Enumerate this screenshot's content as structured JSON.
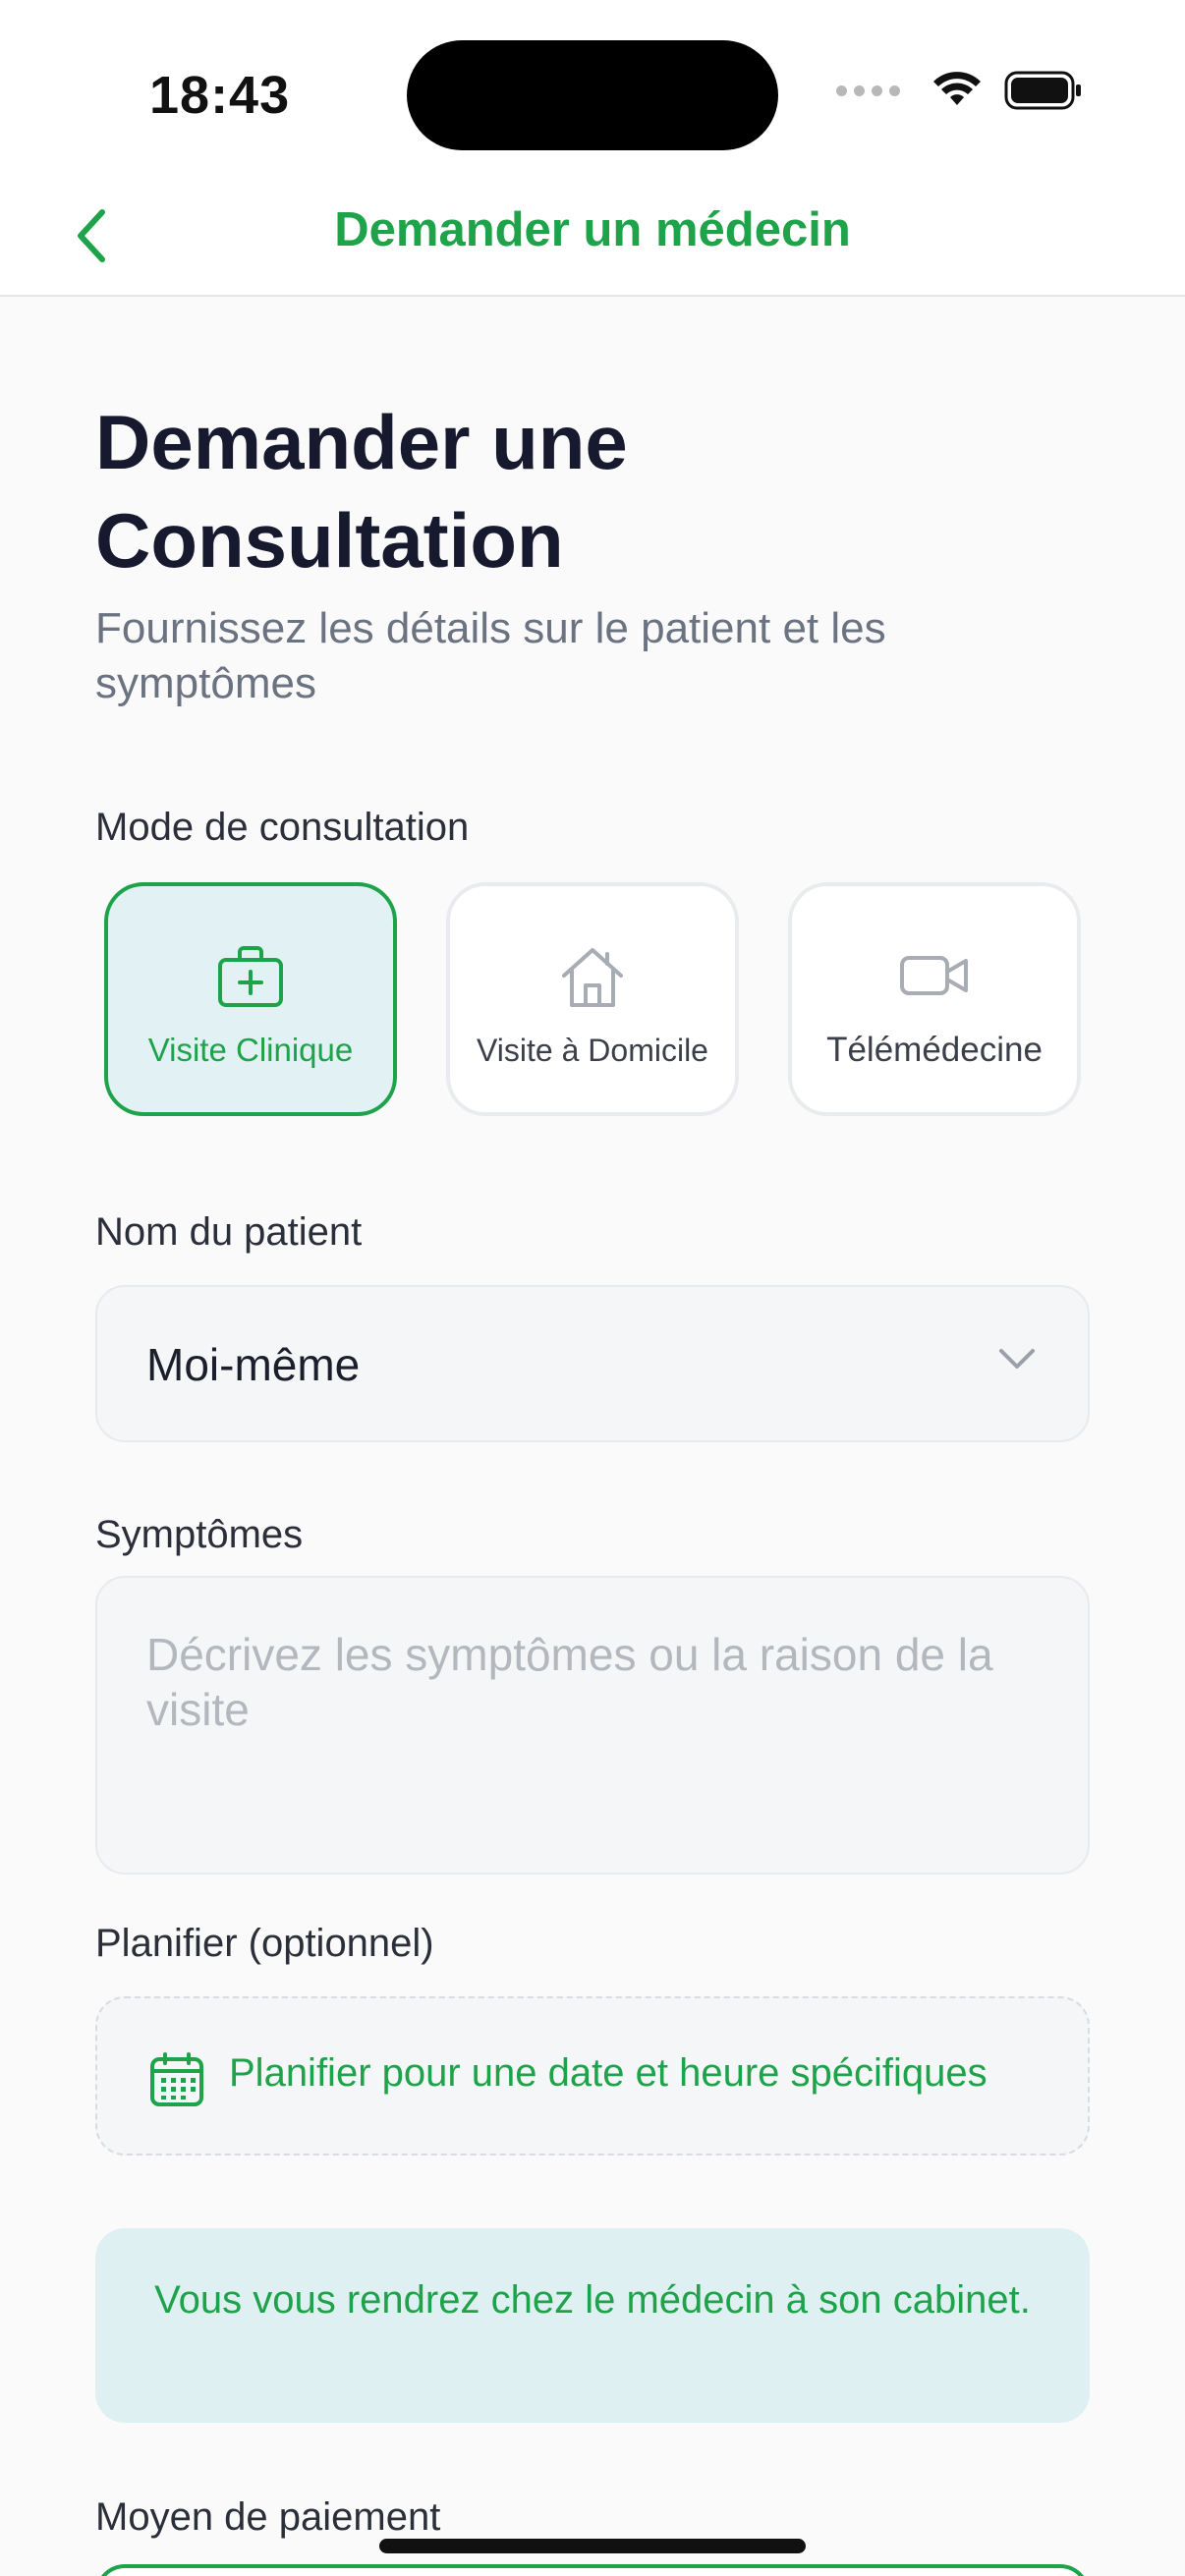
{
  "status_bar": {
    "time": "18:43"
  },
  "nav": {
    "title": "Demander un médecin"
  },
  "page": {
    "title": "Demander une Consultation",
    "subtitle": "Fournissez les détails sur le patient et les symptômes"
  },
  "consultation_mode": {
    "label": "Mode de consultation",
    "options": [
      {
        "label": "Visite Clinique",
        "icon": "medical-kit-icon",
        "selected": true
      },
      {
        "label": "Visite à Domicile",
        "icon": "home-icon",
        "selected": false
      },
      {
        "label": "Télémédecine",
        "icon": "video-camera-icon",
        "selected": false
      }
    ]
  },
  "patient": {
    "label": "Nom du patient",
    "value": "Moi-même"
  },
  "symptoms": {
    "label": "Symptômes",
    "placeholder": "Décrivez les symptômes ou la raison de la visite"
  },
  "schedule": {
    "label": "Planifier (optionnel)",
    "button_label": "Planifier pour une date et heure spécifiques"
  },
  "info": {
    "text": "Vous vous rendrez chez le médecin à son cabinet."
  },
  "payment": {
    "label": "Moyen de paiement"
  },
  "colors": {
    "accent": "#1ea34a",
    "title": "#171a2e",
    "selected_bg": "#e2f1f4"
  }
}
